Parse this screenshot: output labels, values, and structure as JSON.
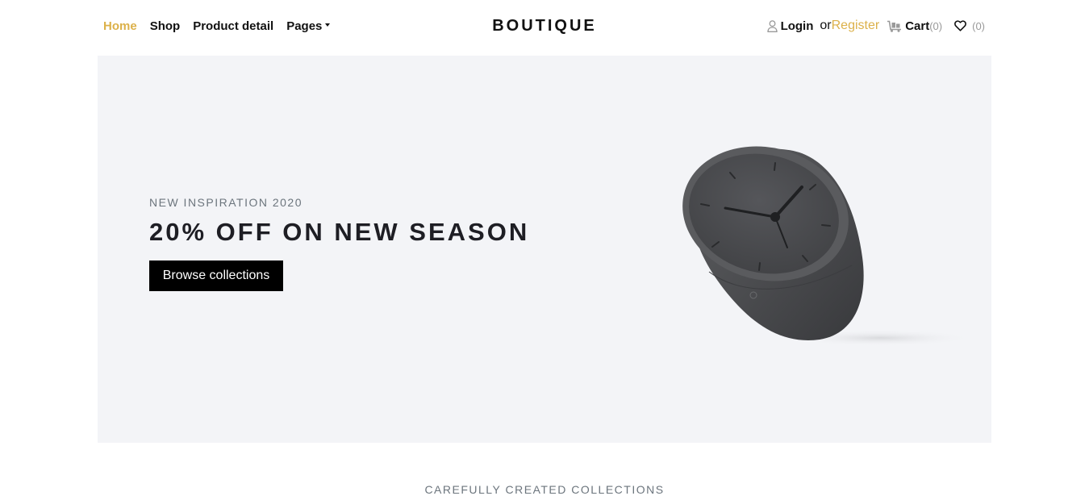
{
  "nav": {
    "left": [
      {
        "label": "Home",
        "active": true
      },
      {
        "label": "Shop"
      },
      {
        "label": "Product detail"
      },
      {
        "label": "Pages"
      }
    ],
    "brand": "BOUTIQUE",
    "right": {
      "login": "Login",
      "or": "or",
      "register": "Register",
      "cart": "Cart",
      "cart_count": "(0)",
      "wishlist_count": "(0)"
    }
  },
  "hero": {
    "kicker": "NEW INSPIRATION 2020",
    "title": "20% OFF ON NEW SEASON",
    "button": "Browse collections"
  },
  "section": {
    "kicker": "CAREFULLY CREATED COLLECTIONS"
  },
  "colors": {
    "accent": "#dcb14a",
    "hero_bg": "#f3f4f7",
    "button_bg": "#000000"
  },
  "icons": [
    "user-icon",
    "dolly-icon",
    "heart-icon",
    "caret-down-icon"
  ]
}
